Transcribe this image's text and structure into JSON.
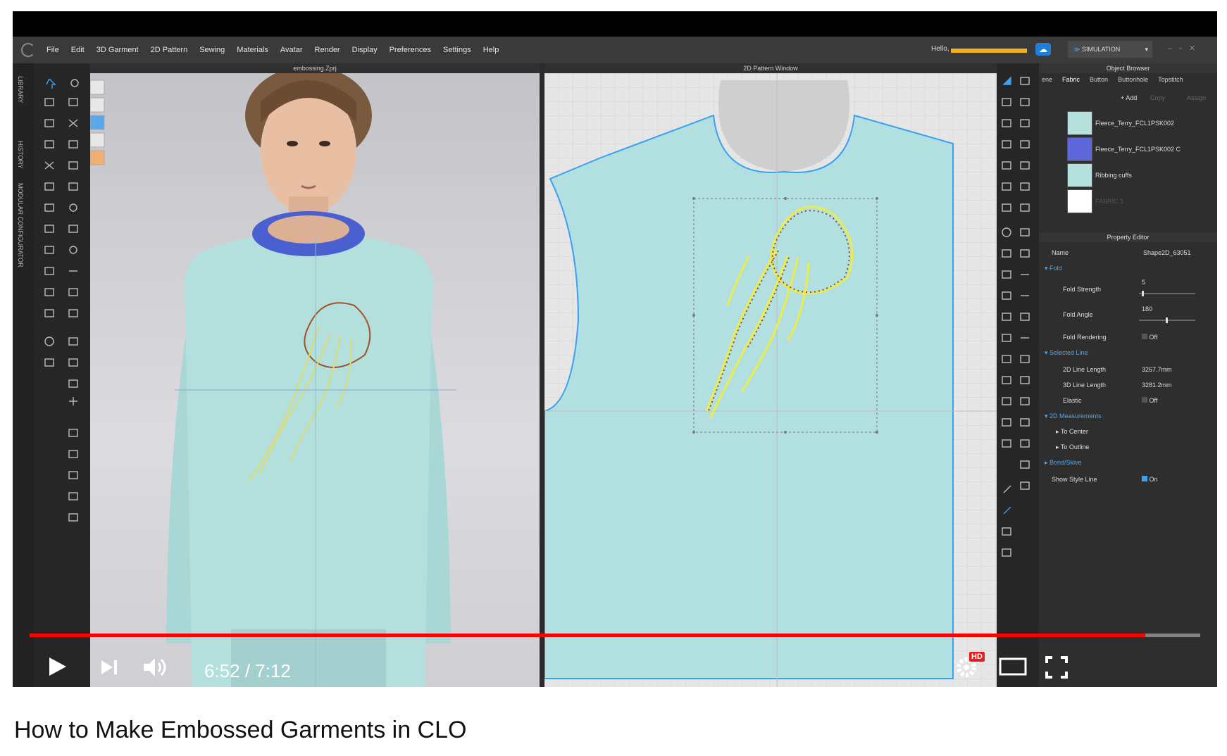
{
  "app": {
    "menus": [
      "File",
      "Edit",
      "3D Garment",
      "2D Pattern",
      "Sewing",
      "Materials",
      "Avatar",
      "Render",
      "Display",
      "Preferences",
      "Settings",
      "Help"
    ],
    "greeting": "Hello,",
    "mode": "SIMULATION"
  },
  "side_tabs": [
    "LIBRARY",
    "HISTORY",
    "MODULAR CONFIGURATOR"
  ],
  "viewport3d": {
    "title": "embossing.Zprj"
  },
  "viewport2d": {
    "title": "2D Pattern Window"
  },
  "object_browser": {
    "title": "Object Browser",
    "tabs": [
      "ene",
      "Fabric",
      "Button",
      "Buttonhole",
      "Topstitch"
    ],
    "active_tab": "Fabric",
    "actions": [
      "+ Add",
      "Copy",
      "Assign"
    ],
    "fabrics": [
      {
        "name": "Fleece_Terry_FCL1PSK002",
        "color": "#b6e0dc"
      },
      {
        "name": "Fleece_Terry_FCL1PSK002 C",
        "color": "#5e67d9"
      },
      {
        "name": "Ribbing cuffs",
        "color": "#b4e0dd"
      },
      {
        "name": "FABRIC 3",
        "color": "#ffffff"
      }
    ]
  },
  "property_editor": {
    "title": "Property Editor",
    "name_label": "Name",
    "name_value": "Shape2D_63051",
    "sections": {
      "fold": "Fold",
      "selected_line": "Selected Line",
      "measurements": "2D Measurements",
      "bond": "Bond/Skive"
    },
    "fold_strength": {
      "label": "Fold Strength",
      "value": "5"
    },
    "fold_angle": {
      "label": "Fold Angle",
      "value": "180"
    },
    "fold_rendering": {
      "label": "Fold Rendering",
      "value": "Off"
    },
    "line2d": {
      "label": "2D Line Length",
      "value": "3267.7mm"
    },
    "line3d": {
      "label": "3D Line Length",
      "value": "3281.2mm"
    },
    "elastic": {
      "label": "Elastic",
      "value": "Off"
    },
    "to_center": "To Center",
    "to_outline": "To Outline",
    "style_line": {
      "label": "Show Style Line",
      "value": "On"
    }
  },
  "player": {
    "time": "6:52 / 7:12",
    "progress": 0.953,
    "hd_badge": "HD"
  },
  "video_title": "How to Make Embossed Garments in CLO"
}
